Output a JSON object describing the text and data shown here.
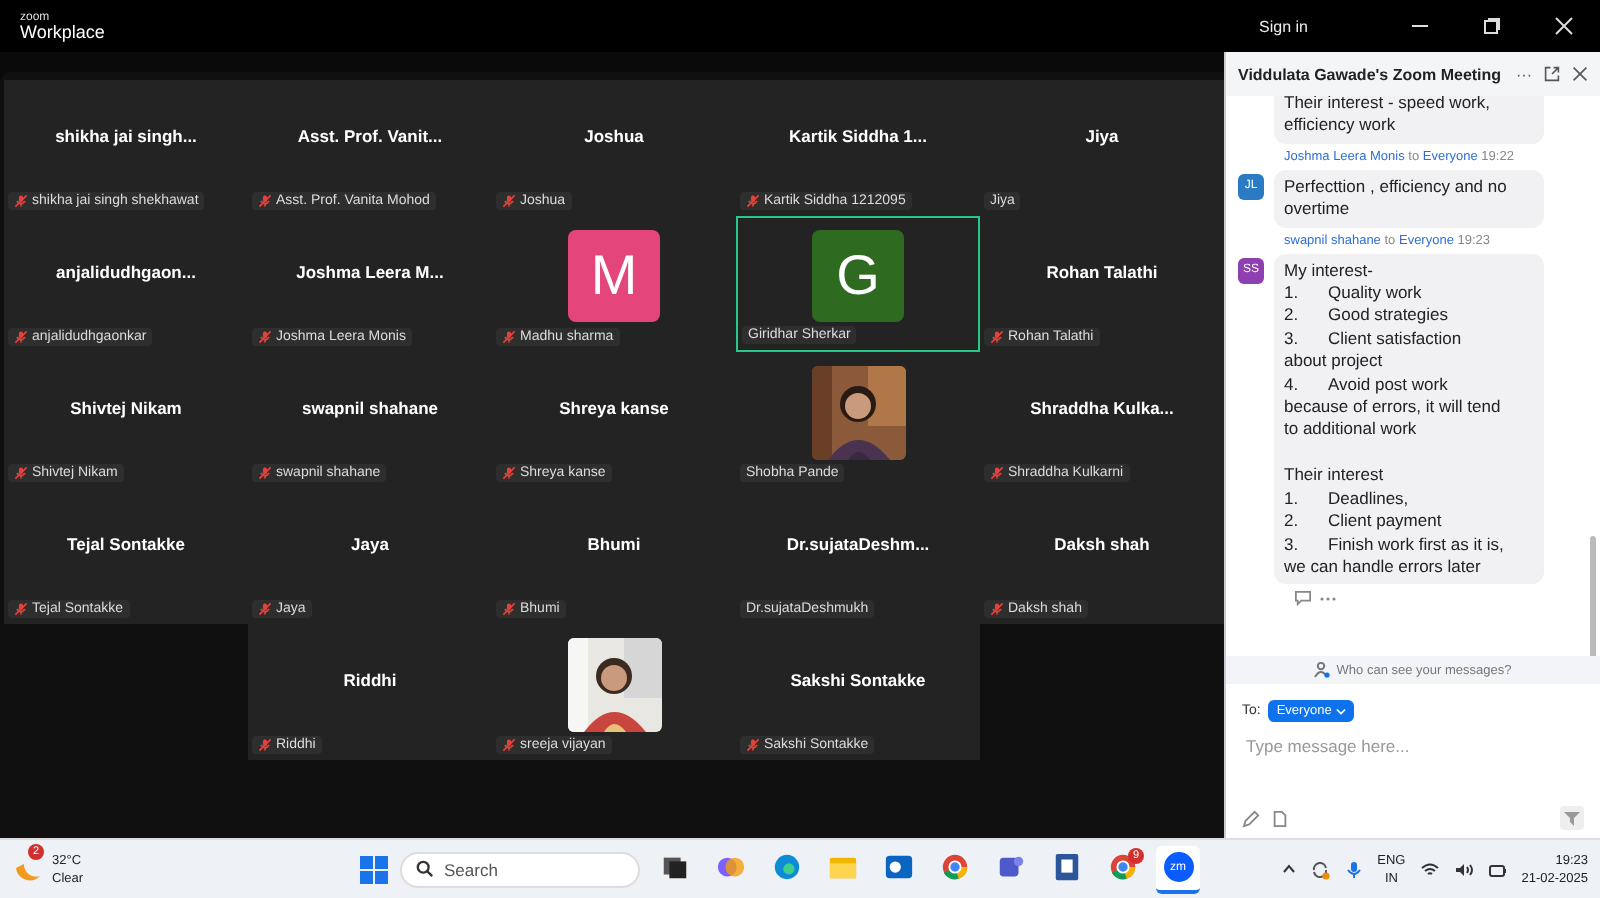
{
  "window": {
    "logo_top": "zoom",
    "logo_bottom": "Workplace",
    "sign_in": "Sign in"
  },
  "gallery": {
    "rows": [
      [
        {
          "title": "shikha jai singh...",
          "label": "shikha jai singh shekhawat",
          "muted": true,
          "kind": "name",
          "speaking": false
        },
        {
          "title": "Asst. Prof. Vanit...",
          "label": "Asst. Prof. Vanita Mohod",
          "muted": true,
          "kind": "name",
          "speaking": false
        },
        {
          "title": "Joshua",
          "label": "Joshua",
          "muted": true,
          "kind": "name",
          "speaking": false
        },
        {
          "title": "Kartik Siddha 1...",
          "label": "Kartik Siddha 1212095",
          "muted": true,
          "kind": "name",
          "speaking": false
        },
        {
          "title": "Jiya",
          "label": "Jiya",
          "muted": false,
          "kind": "name",
          "speaking": false
        }
      ],
      [
        {
          "title": "anjalidudhgaon...",
          "label": "anjalidudhgaonkar",
          "muted": true,
          "kind": "name",
          "speaking": false
        },
        {
          "title": "Joshma Leera M...",
          "label": "Joshma Leera Monis",
          "muted": true,
          "kind": "name",
          "speaking": false
        },
        {
          "letter": "M",
          "color": "#e4457b",
          "label": "Madhu sharma",
          "muted": true,
          "kind": "letter",
          "speaking": false
        },
        {
          "letter": "G",
          "color": "#2e6a1f",
          "label": "Giridhar Sherkar",
          "muted": false,
          "kind": "letter",
          "speaking": true
        },
        {
          "title": "Rohan Talathi",
          "label": "Rohan Talathi",
          "muted": true,
          "kind": "name",
          "speaking": false
        }
      ],
      [
        {
          "title": "Shivtej Nikam",
          "label": "Shivtej Nikam",
          "muted": true,
          "kind": "name",
          "speaking": false
        },
        {
          "title": "swapnil shahane",
          "label": "swapnil shahane",
          "muted": true,
          "kind": "name",
          "speaking": false
        },
        {
          "title": "Shreya kanse",
          "label": "Shreya kanse",
          "muted": true,
          "kind": "name",
          "speaking": false
        },
        {
          "label": "Shobha Pande",
          "muted": false,
          "speaking": false
        },
        {
          "title": "Shraddha  Kulka...",
          "label": "Shraddha Kulkarni",
          "muted": true,
          "kind": "name",
          "speaking": false
        }
      ],
      [
        {
          "title": "Tejal Sontakke",
          "label": "Tejal Sontakke",
          "muted": true,
          "kind": "name",
          "speaking": false
        },
        {
          "title": "Jaya",
          "label": "Jaya",
          "muted": true,
          "kind": "name",
          "speaking": false
        },
        {
          "title": "Bhumi",
          "label": "Bhumi",
          "muted": true,
          "kind": "name",
          "speaking": false
        },
        {
          "title": "Dr.sujataDeshm...",
          "label": "Dr.sujataDeshmukh",
          "muted": false,
          "kind": "name",
          "speaking": false
        },
        {
          "title": "Daksh shah",
          "label": "Daksh shah",
          "muted": true,
          "kind": "name",
          "speaking": false
        }
      ],
      [
        "",
        {
          "title": "Riddhi",
          "label": "Riddhi",
          "muted": true,
          "kind": "name",
          "speaking": false
        },
        {
          "label": "sreeja vijayan",
          "muted": true,
          "speaking": false
        },
        {
          "title": "Sakshi Sontakke",
          "label": "Sakshi Sontakke",
          "muted": true,
          "kind": "name",
          "speaking": false
        }
      ]
    ]
  },
  "chat": {
    "title": "Viddulata Gawade's Zoom Meeting",
    "messages": [
      {
        "text": "Their interest - speed work,\nefficiency work"
      },
      {
        "sender": "Joshma Leera Monis",
        "to_word": "to",
        "recipient": "Everyone",
        "time": "19:22",
        "initials": "JL",
        "color": "#2b7bc4",
        "text": "Perfecttion , efficiency and no\novertime"
      },
      {
        "sender": "swapnil shahane",
        "to_word": "to",
        "recipient": "Everyone",
        "time": "19:23",
        "initials": "SS",
        "color": "#8e3fb0",
        "text": "My interest-\n1.\tQuality work\n2.\tGood strategies\n3.\tClient satisfaction\nabout project\n4.\tAvoid post work\nbecause of errors, it will tend\nto additional work\n\nTheir interest\n1.\tDeadlines,\n2.\tClient payment\n3.\tFinish work first as it is,\nwe can handle errors later"
      }
    ],
    "more": "···",
    "privacy": "Who can see your messages?",
    "to_label": "To:",
    "to_value": "Everyone",
    "placeholder": "Type message here..."
  },
  "taskbar": {
    "temp": "32°C",
    "condition": "Clear",
    "weather_badge": "2",
    "search": "Search",
    "apps": [
      {
        "kind": "taskview",
        "selected": false
      },
      {
        "kind": "copilot",
        "selected": false
      },
      {
        "kind": "edge",
        "selected": false
      },
      {
        "kind": "folder",
        "selected": false
      },
      {
        "kind": "mail",
        "selected": false
      },
      {
        "kind": "chrome",
        "selected": false
      },
      {
        "kind": "teams",
        "selected": false
      },
      {
        "kind": "doc",
        "selected": false
      },
      {
        "kind": "chrome",
        "selected": false,
        "badge": "9"
      },
      {
        "kind": "zoom",
        "selected": true,
        "text": "zm"
      }
    ],
    "lang_top": "ENG",
    "lang_bottom": "IN",
    "time": "19:23",
    "date": "21-02-2025"
  }
}
